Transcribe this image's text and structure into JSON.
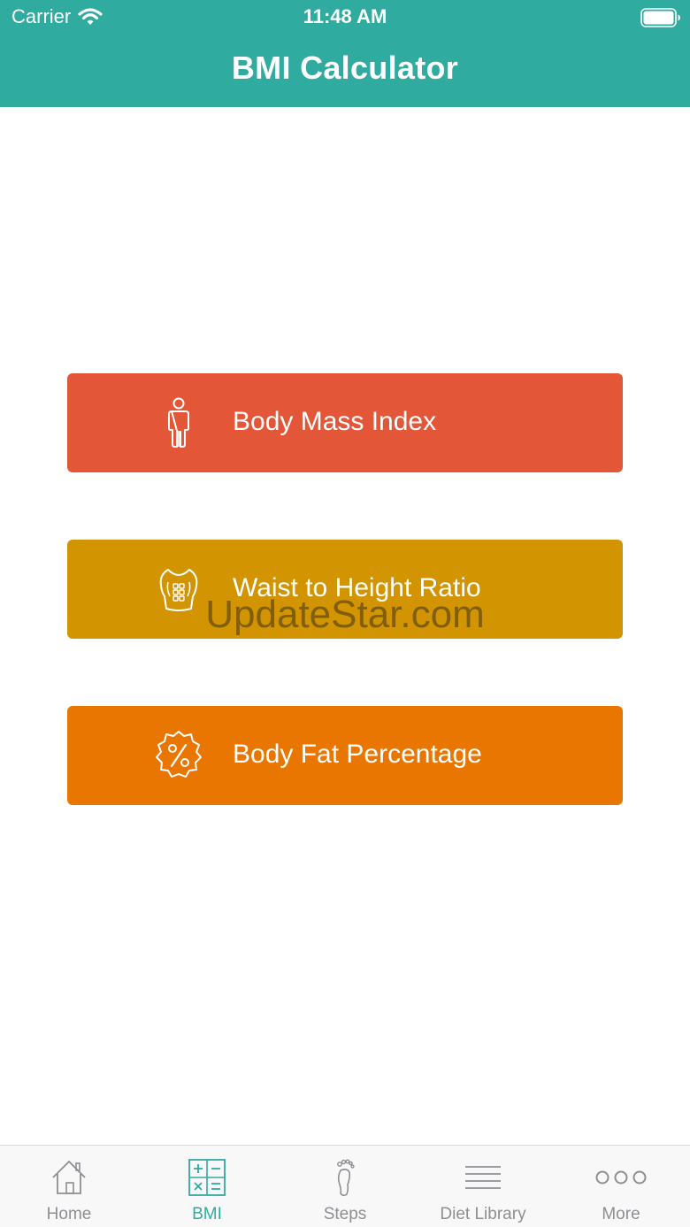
{
  "status_bar": {
    "carrier": "Carrier",
    "time": "11:48 AM"
  },
  "nav": {
    "title": "BMI Calculator"
  },
  "actions": [
    {
      "label": "Body Mass Index",
      "icon": "person-icon",
      "color": "#e35637"
    },
    {
      "label": "Waist to Height Ratio",
      "icon": "torso-icon",
      "color": "#d29400"
    },
    {
      "label": "Body Fat Percentage",
      "icon": "percent-badge-icon",
      "color": "#e87600"
    }
  ],
  "watermark": "UpdateStar.com",
  "tab_bar": {
    "active_color": "#30ab9f",
    "inactive_color": "#8e8e93",
    "tabs": [
      {
        "label": "Home",
        "icon": "home-icon"
      },
      {
        "label": "BMI",
        "icon": "calculator-icon",
        "active": true
      },
      {
        "label": "Steps",
        "icon": "footprint-icon"
      },
      {
        "label": "Diet Library",
        "icon": "list-lines-icon"
      },
      {
        "label": "More",
        "icon": "more-dots-icon"
      }
    ]
  },
  "colors": {
    "header": "#30ab9f",
    "background": "#ffffff"
  }
}
